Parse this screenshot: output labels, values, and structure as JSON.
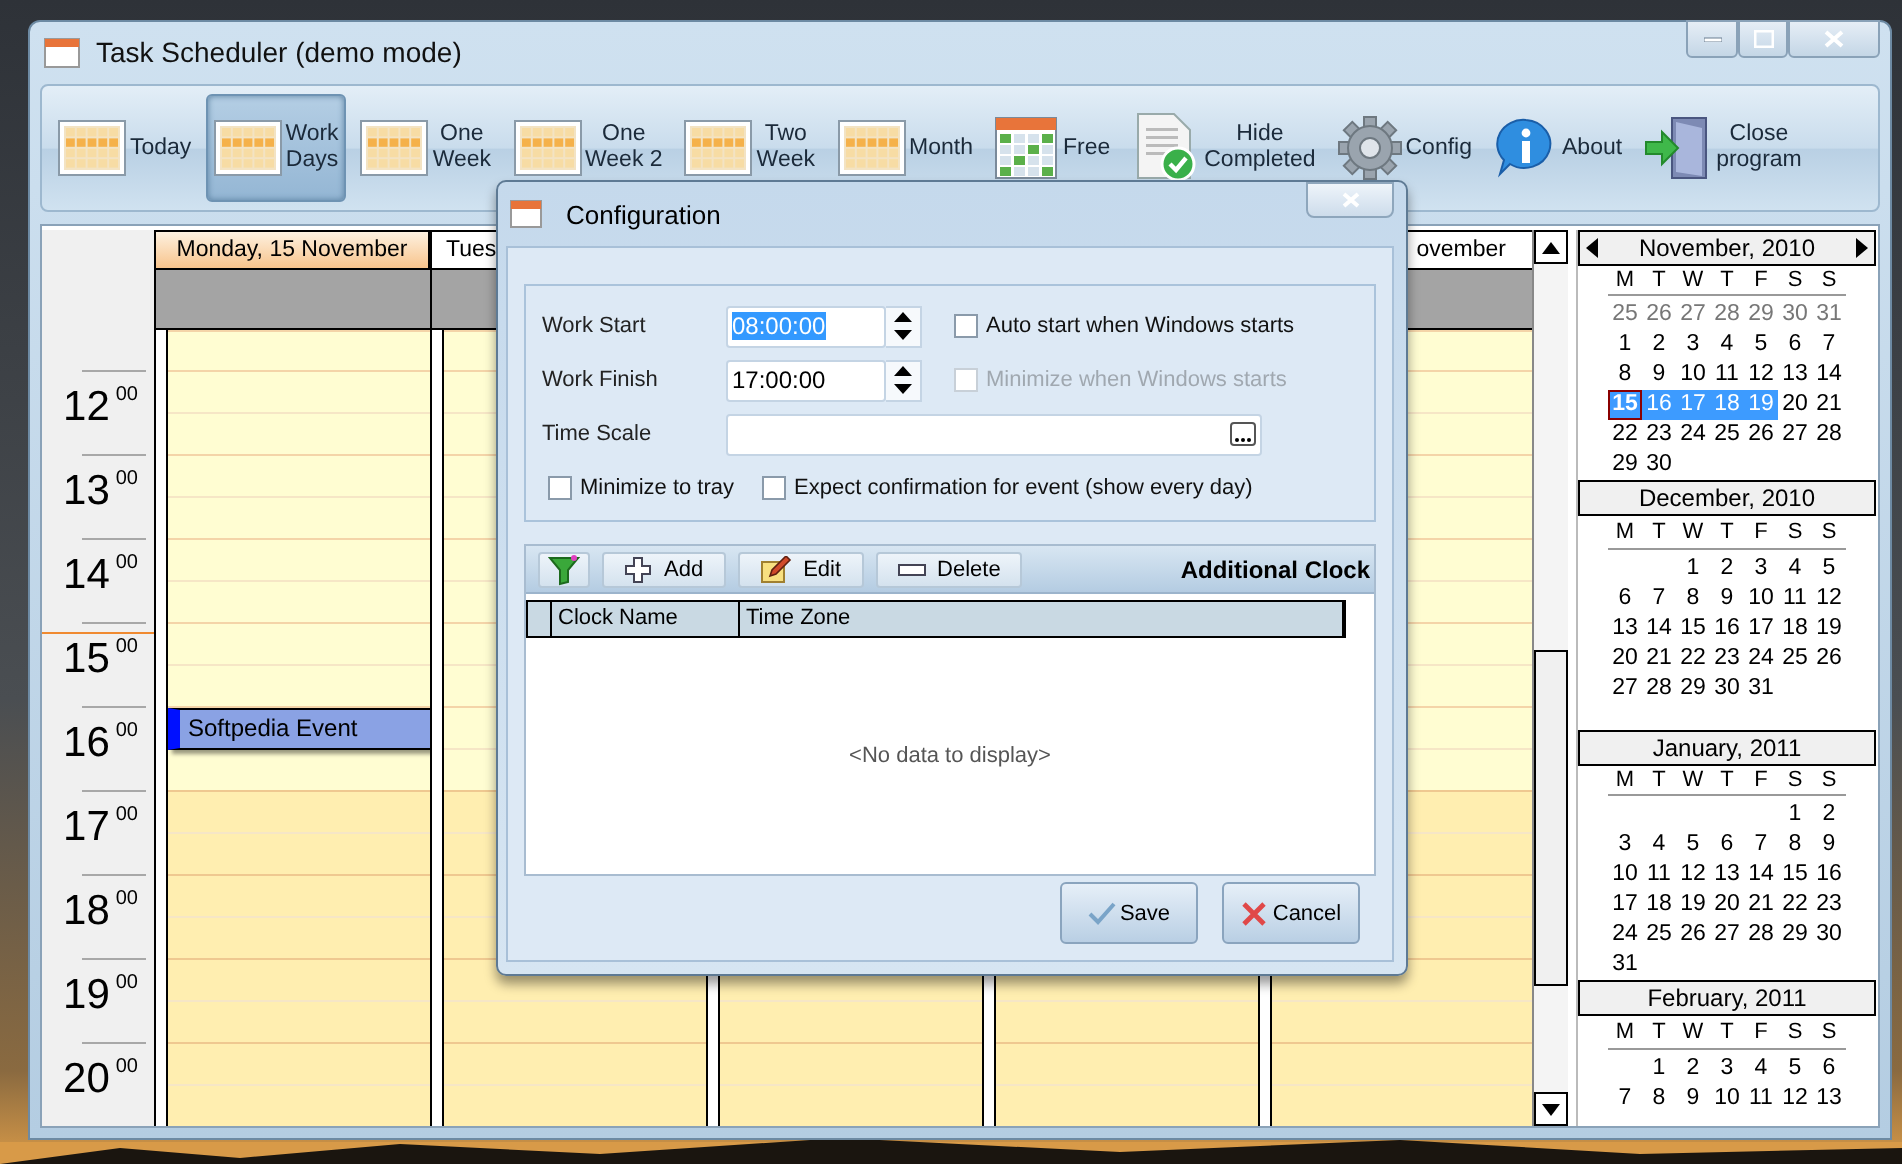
{
  "window": {
    "title": "Task Scheduler (demo mode)"
  },
  "toolbar": [
    {
      "label": "Today",
      "kind": "calendar",
      "selected": false
    },
    {
      "label": "Work\nDays",
      "kind": "calendar",
      "selected": true
    },
    {
      "label": "One\nWeek",
      "kind": "calendar",
      "selected": false
    },
    {
      "label": "One\nWeek 2",
      "kind": "calendar",
      "selected": false
    },
    {
      "label": "Two\nWeek",
      "kind": "calendar",
      "selected": false
    },
    {
      "label": "Month",
      "kind": "calendar",
      "selected": false
    },
    {
      "label": "Free",
      "kind": "free",
      "selected": false
    },
    {
      "label": "Hide\nCompleted",
      "kind": "hide",
      "selected": false
    },
    {
      "label": "Config",
      "kind": "config",
      "selected": false
    },
    {
      "label": "About",
      "kind": "about",
      "selected": false
    },
    {
      "label": "Close\nprogram",
      "kind": "exit",
      "selected": false
    }
  ],
  "scheduler": {
    "hours": [
      {
        "label": "12",
        "minutes": "00",
        "work": true,
        "current": false
      },
      {
        "label": "13",
        "minutes": "00",
        "work": true,
        "current": false
      },
      {
        "label": "14",
        "minutes": "00",
        "work": true,
        "current": false
      },
      {
        "label": "15",
        "minutes": "00",
        "work": true,
        "current": true
      },
      {
        "label": "16",
        "minutes": "00",
        "work": true,
        "current": false
      },
      {
        "label": "17",
        "minutes": "00",
        "work": false,
        "current": false
      },
      {
        "label": "18",
        "minutes": "00",
        "work": false,
        "current": false
      },
      {
        "label": "19",
        "minutes": "00",
        "work": false,
        "current": false
      },
      {
        "label": "20",
        "minutes": "00",
        "work": false,
        "current": false
      }
    ],
    "days": [
      {
        "header": "Monday, 15 November",
        "selected": true,
        "cut_start": false,
        "cut_end": false,
        "slots": [
          {
            "busy": false
          },
          {
            "busy": false
          },
          {
            "busy": false
          },
          {
            "busy": false
          },
          {
            "busy": true,
            "title": "Softpedia Event"
          },
          {
            "busy": false
          },
          {
            "busy": false
          },
          {
            "busy": false
          },
          {
            "busy": false
          }
        ]
      },
      {
        "header": "Tues",
        "selected": false,
        "cut_start": false,
        "cut_end": true
      },
      {
        "header": "ovember",
        "selected": false,
        "cut_start": true,
        "cut_end": false
      }
    ]
  },
  "mini_calendars": [
    {
      "title": "November, 2010",
      "nav": true,
      "weekdays": [
        "M",
        "T",
        "W",
        "T",
        "F",
        "S",
        "S"
      ],
      "weeks": [
        [
          {
            "day": "25",
            "selected": false,
            "today": false,
            "muted": true
          },
          {
            "day": "26",
            "selected": false,
            "today": false,
            "muted": true
          },
          {
            "day": "27",
            "selected": false,
            "today": false,
            "muted": true
          },
          {
            "day": "28",
            "selected": false,
            "today": false,
            "muted": true
          },
          {
            "day": "29",
            "selected": false,
            "today": false,
            "muted": true
          },
          {
            "day": "30",
            "selected": false,
            "today": false,
            "muted": true
          },
          {
            "day": "31",
            "selected": false,
            "today": false,
            "muted": true
          }
        ],
        [
          {
            "day": "1",
            "selected": false,
            "today": false,
            "muted": false
          },
          {
            "day": "2",
            "selected": false,
            "today": false,
            "muted": false
          },
          {
            "day": "3",
            "selected": false,
            "today": false,
            "muted": false
          },
          {
            "day": "4",
            "selected": false,
            "today": false,
            "muted": false
          },
          {
            "day": "5",
            "selected": false,
            "today": false,
            "muted": false
          },
          {
            "day": "6",
            "selected": false,
            "today": false,
            "muted": false
          },
          {
            "day": "7",
            "selected": false,
            "today": false,
            "muted": false
          }
        ],
        [
          {
            "day": "8",
            "selected": false,
            "today": false,
            "muted": false
          },
          {
            "day": "9",
            "selected": false,
            "today": false,
            "muted": false
          },
          {
            "day": "10",
            "selected": false,
            "today": false,
            "muted": false
          },
          {
            "day": "11",
            "selected": false,
            "today": false,
            "muted": false
          },
          {
            "day": "12",
            "selected": false,
            "today": false,
            "muted": false
          },
          {
            "day": "13",
            "selected": false,
            "today": false,
            "muted": false
          },
          {
            "day": "14",
            "selected": false,
            "today": false,
            "muted": false
          }
        ],
        [
          {
            "day": "15",
            "selected": true,
            "today": true,
            "muted": false
          },
          {
            "day": "16",
            "selected": true,
            "today": false,
            "muted": false
          },
          {
            "day": "17",
            "selected": true,
            "today": false,
            "muted": false
          },
          {
            "day": "18",
            "selected": true,
            "today": false,
            "muted": false
          },
          {
            "day": "19",
            "selected": true,
            "today": false,
            "muted": false
          },
          {
            "day": "20",
            "selected": false,
            "today": false,
            "muted": false
          },
          {
            "day": "21",
            "selected": false,
            "today": false,
            "muted": false
          }
        ],
        [
          {
            "day": "22",
            "selected": false,
            "today": false,
            "muted": false
          },
          {
            "day": "23",
            "selected": false,
            "today": false,
            "muted": false
          },
          {
            "day": "24",
            "selected": false,
            "today": false,
            "muted": false
          },
          {
            "day": "25",
            "selected": false,
            "today": false,
            "muted": false
          },
          {
            "day": "26",
            "selected": false,
            "today": false,
            "muted": false
          },
          {
            "day": "27",
            "selected": false,
            "today": false,
            "muted": false
          },
          {
            "day": "28",
            "selected": false,
            "today": false,
            "muted": false
          }
        ],
        [
          {
            "day": "29",
            "selected": false,
            "today": false,
            "muted": false
          },
          {
            "day": "30",
            "selected": false,
            "today": false,
            "muted": false
          }
        ]
      ]
    },
    {
      "title": "December, 2010",
      "nav": false,
      "weekdays": [
        "M",
        "T",
        "W",
        "T",
        "F",
        "S",
        "S"
      ],
      "weeks": [
        [
          {
            "day": "1",
            "selected": false,
            "today": false,
            "muted": false
          },
          {
            "day": "2",
            "selected": false,
            "today": false,
            "muted": false
          },
          {
            "day": "3",
            "selected": false,
            "today": false,
            "muted": false
          },
          {
            "day": "4",
            "selected": false,
            "today": false,
            "muted": false
          },
          {
            "day": "5",
            "selected": false,
            "today": false,
            "muted": false
          }
        ],
        [
          {
            "day": "6",
            "selected": false,
            "today": false,
            "muted": false
          },
          {
            "day": "7",
            "selected": false,
            "today": false,
            "muted": false
          },
          {
            "day": "8",
            "selected": false,
            "today": false,
            "muted": false
          },
          {
            "day": "9",
            "selected": false,
            "today": false,
            "muted": false
          },
          {
            "day": "10",
            "selected": false,
            "today": false,
            "muted": false
          },
          {
            "day": "11",
            "selected": false,
            "today": false,
            "muted": false
          },
          {
            "day": "12",
            "selected": false,
            "today": false,
            "muted": false
          }
        ],
        [
          {
            "day": "13",
            "selected": false,
            "today": false,
            "muted": false
          },
          {
            "day": "14",
            "selected": false,
            "today": false,
            "muted": false
          },
          {
            "day": "15",
            "selected": false,
            "today": false,
            "muted": false
          },
          {
            "day": "16",
            "selected": false,
            "today": false,
            "muted": false
          },
          {
            "day": "17",
            "selected": false,
            "today": false,
            "muted": false
          },
          {
            "day": "18",
            "selected": false,
            "today": false,
            "muted": false
          },
          {
            "day": "19",
            "selected": false,
            "today": false,
            "muted": false
          }
        ],
        [
          {
            "day": "20",
            "selected": false,
            "today": false,
            "muted": false
          },
          {
            "day": "21",
            "selected": false,
            "today": false,
            "muted": false
          },
          {
            "day": "22",
            "selected": false,
            "today": false,
            "muted": false
          },
          {
            "day": "23",
            "selected": false,
            "today": false,
            "muted": false
          },
          {
            "day": "24",
            "selected": false,
            "today": false,
            "muted": false
          },
          {
            "day": "25",
            "selected": false,
            "today": false,
            "muted": false
          },
          {
            "day": "26",
            "selected": false,
            "today": false,
            "muted": false
          }
        ],
        [
          {
            "day": "27",
            "selected": false,
            "today": false,
            "muted": false
          },
          {
            "day": "28",
            "selected": false,
            "today": false,
            "muted": false
          },
          {
            "day": "29",
            "selected": false,
            "today": false,
            "muted": false
          },
          {
            "day": "30",
            "selected": false,
            "today": false,
            "muted": false
          },
          {
            "day": "31",
            "selected": false,
            "today": false,
            "muted": false
          }
        ]
      ]
    },
    {
      "title": "January, 2011",
      "nav": false,
      "weekdays": [
        "M",
        "T",
        "W",
        "T",
        "F",
        "S",
        "S"
      ],
      "weeks": [
        [
          {
            "day": "1",
            "selected": false,
            "today": false,
            "muted": false
          },
          {
            "day": "2",
            "selected": false,
            "today": false,
            "muted": false
          }
        ],
        [
          {
            "day": "3",
            "selected": false,
            "today": false,
            "muted": false
          },
          {
            "day": "4",
            "selected": false,
            "today": false,
            "muted": false
          },
          {
            "day": "5",
            "selected": false,
            "today": false,
            "muted": false
          },
          {
            "day": "6",
            "selected": false,
            "today": false,
            "muted": false
          },
          {
            "day": "7",
            "selected": false,
            "today": false,
            "muted": false
          },
          {
            "day": "8",
            "selected": false,
            "today": false,
            "muted": false
          },
          {
            "day": "9",
            "selected": false,
            "today": false,
            "muted": false
          }
        ],
        [
          {
            "day": "10",
            "selected": false,
            "today": false,
            "muted": false
          },
          {
            "day": "11",
            "selected": false,
            "today": false,
            "muted": false
          },
          {
            "day": "12",
            "selected": false,
            "today": false,
            "muted": false
          },
          {
            "day": "13",
            "selected": false,
            "today": false,
            "muted": false
          },
          {
            "day": "14",
            "selected": false,
            "today": false,
            "muted": false
          },
          {
            "day": "15",
            "selected": false,
            "today": false,
            "muted": false
          },
          {
            "day": "16",
            "selected": false,
            "today": false,
            "muted": false
          }
        ],
        [
          {
            "day": "17",
            "selected": false,
            "today": false,
            "muted": false
          },
          {
            "day": "18",
            "selected": false,
            "today": false,
            "muted": false
          },
          {
            "day": "19",
            "selected": false,
            "today": false,
            "muted": false
          },
          {
            "day": "20",
            "selected": false,
            "today": false,
            "muted": false
          },
          {
            "day": "21",
            "selected": false,
            "today": false,
            "muted": false
          },
          {
            "day": "22",
            "selected": false,
            "today": false,
            "muted": false
          },
          {
            "day": "23",
            "selected": false,
            "today": false,
            "muted": false
          }
        ],
        [
          {
            "day": "24",
            "selected": false,
            "today": false,
            "muted": false
          },
          {
            "day": "25",
            "selected": false,
            "today": false,
            "muted": false
          },
          {
            "day": "26",
            "selected": false,
            "today": false,
            "muted": false
          },
          {
            "day": "27",
            "selected": false,
            "today": false,
            "muted": false
          },
          {
            "day": "28",
            "selected": false,
            "today": false,
            "muted": false
          },
          {
            "day": "29",
            "selected": false,
            "today": false,
            "muted": false
          },
          {
            "day": "30",
            "selected": false,
            "today": false,
            "muted": false
          }
        ],
        [
          {
            "day": "31",
            "selected": false,
            "today": false,
            "muted": false
          }
        ]
      ]
    },
    {
      "title": "February, 2011",
      "nav": false,
      "weekdays": [
        "M",
        "T",
        "W",
        "T",
        "F",
        "S",
        "S"
      ],
      "weeks": [
        [
          {
            "day": "1",
            "selected": false,
            "today": false,
            "muted": false
          },
          {
            "day": "2",
            "selected": false,
            "today": false,
            "muted": false
          },
          {
            "day": "3",
            "selected": false,
            "today": false,
            "muted": false
          },
          {
            "day": "4",
            "selected": false,
            "today": false,
            "muted": false
          },
          {
            "day": "5",
            "selected": false,
            "today": false,
            "muted": false
          },
          {
            "day": "6",
            "selected": false,
            "today": false,
            "muted": false
          }
        ],
        [
          {
            "day": "7",
            "selected": false,
            "today": false,
            "muted": false
          },
          {
            "day": "8",
            "selected": false,
            "today": false,
            "muted": false
          },
          {
            "day": "9",
            "selected": false,
            "today": false,
            "muted": false
          },
          {
            "day": "10",
            "selected": false,
            "today": false,
            "muted": false
          },
          {
            "day": "11",
            "selected": false,
            "today": false,
            "muted": false
          },
          {
            "day": "12",
            "selected": false,
            "today": false,
            "muted": false
          },
          {
            "day": "13",
            "selected": false,
            "today": false,
            "muted": false
          }
        ]
      ]
    }
  ],
  "dialog": {
    "title": "Configuration",
    "fields": [
      {
        "label": "Work Start",
        "kind": "spin",
        "value": "08:00:00",
        "text_selected": true
      },
      {
        "label": "Work Finish",
        "kind": "spin",
        "value": "17:00:00",
        "text_selected": false
      },
      {
        "label": "Time Scale",
        "kind": "picker"
      }
    ],
    "side_options": [
      {
        "label": "Auto start when Windows starts",
        "checked": false,
        "disabled": false
      },
      {
        "label": "Minimize when Windows starts",
        "checked": false,
        "disabled": true
      }
    ],
    "options": [
      {
        "label": "Minimize to tray",
        "checked": false
      },
      {
        "label": "Expect confirmation for event (show every day)",
        "checked": false
      }
    ],
    "grid": {
      "title": "Additional Clock",
      "tools": [
        {
          "kind": "filter"
        },
        {
          "kind": "add",
          "label": "Add"
        },
        {
          "kind": "edit",
          "label": "Edit"
        },
        {
          "kind": "delete",
          "label": "Delete"
        }
      ],
      "columns": [
        "Clock Name",
        "Time Zone"
      ],
      "empty": "<No data to display>"
    },
    "buttons": [
      {
        "kind": "save",
        "label": "Save"
      },
      {
        "kind": "cancel",
        "label": "Cancel"
      }
    ]
  }
}
